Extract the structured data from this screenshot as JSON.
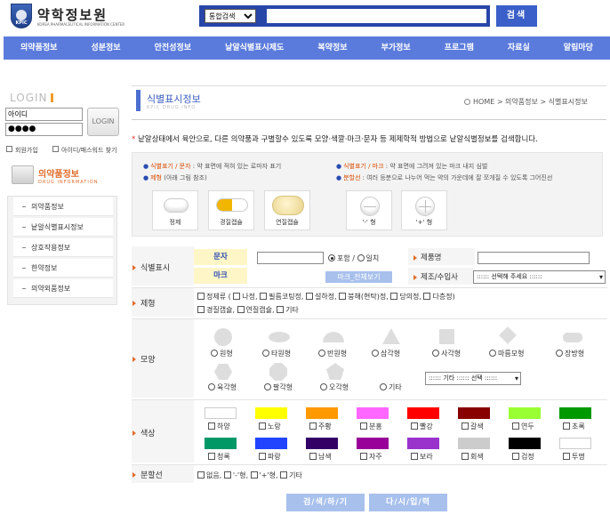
{
  "header": {
    "logo_text": "약학정보원",
    "logo_badge": "KPIC",
    "logo_sub": "KOREA PHARMACEUTICAL INFORMATION CENTER",
    "search_select": "통합검색",
    "search_button": "검색"
  },
  "nav": [
    "의약품정보",
    "성분정보",
    "안전성정보",
    "낱알식별표시제도",
    "복약정보",
    "부가정보",
    "프로그램",
    "자료실",
    "알림마당"
  ],
  "login": {
    "title": "LOGIN",
    "id_value": "아이디",
    "pw_value": "●●●●",
    "button": "LOGIN",
    "join": "회원가입",
    "find": "아이디/패스워드 찾기"
  },
  "sidebar": {
    "title": "의약품정보",
    "subtitle": "DRUG INFORMATION",
    "items": [
      "의약품정보",
      "낱알식별표시정보",
      "상호작용정보",
      "한약정보",
      "의약외품정보"
    ]
  },
  "page": {
    "title": "식별표시정보",
    "subtitle": "KPIC DRUG INFO",
    "breadcrumb": "HOME > 의약품정보 > 식별표시정보",
    "description": "낱알상태에서 육안으로, 다른 의약품과 구별할수 있도록 모양·색깔·마크·문자 등 제제학적 방법으로 낱알식별정보를 검색합니다."
  },
  "legend": {
    "line1_key": "식별표기 / 문자",
    "line1_text": " : 약 표면에 적혀 있는 로마자 표기",
    "line2_key": "제형",
    "line2_text": " (아래 그림 참조)",
    "line3_key": "식별표기 / 마크",
    "line3_text": " : 약 표면에 그려져 있는 마크 내지 심벌",
    "line4_key": "분할선",
    "line4_text": " : 여러 등분으로 나누어 먹는 약의 가운데에 잘 쪼개질 수 있도록 그어진선",
    "cards": [
      "정제",
      "경질캡슐",
      "연질캡슐",
      "'-' 형",
      "'+' 형"
    ]
  },
  "form": {
    "id_label": "식별표시",
    "char_label": "문자",
    "mark_label": "마크",
    "include": "포함",
    "slash": "/",
    "exact": "일치",
    "mark_view": "마크_전체보기",
    "name_label": "제품명",
    "maker_label": "제조/수입사",
    "maker_select": ":::::: 선택해 주세요 ::::::",
    "form_label": "제형",
    "forms": [
      "정제류 (",
      "나정,",
      "필름코팅정,",
      "설하정,",
      "붕해(현탁)정,",
      "당의정,",
      "다층정)",
      "경질캡슐,",
      "연질캡슐,",
      "기타"
    ],
    "shape_label": "모양",
    "shapes": [
      "원형",
      "타원형",
      "반원형",
      "삼각형",
      "사각형",
      "마름모형",
      "장방형",
      "육각형",
      "팔각형",
      "오각형",
      "기타"
    ],
    "shape_other_select": ":::::: 기타 :::::: 선택 ::::::",
    "color_label": "색상",
    "colors": [
      {
        "name": "하양",
        "hex": "#ffffff"
      },
      {
        "name": "노랑",
        "hex": "#ffff00"
      },
      {
        "name": "주황",
        "hex": "#ff9900"
      },
      {
        "name": "분홍",
        "hex": "#ff66ff"
      },
      {
        "name": "빨강",
        "hex": "#ff0000"
      },
      {
        "name": "갈색",
        "hex": "#880000"
      },
      {
        "name": "연두",
        "hex": "#99ff33"
      },
      {
        "name": "초록",
        "hex": "#009900"
      },
      {
        "name": "청록",
        "hex": "#009966"
      },
      {
        "name": "파랑",
        "hex": "#2244ff"
      },
      {
        "name": "남색",
        "hex": "#330066"
      },
      {
        "name": "자주",
        "hex": "#990099"
      },
      {
        "name": "보라",
        "hex": "#9933cc"
      },
      {
        "name": "회색",
        "hex": "#cccccc"
      },
      {
        "name": "검정",
        "hex": "#000000"
      },
      {
        "name": "투명",
        "hex": "#ffffff"
      }
    ],
    "split_label": "분할선",
    "splits": [
      "없음,",
      "'-'형,",
      "'+'형,",
      "기타"
    ],
    "search_button": "검/색/하/기",
    "reset_button": "다/시/입/력"
  }
}
